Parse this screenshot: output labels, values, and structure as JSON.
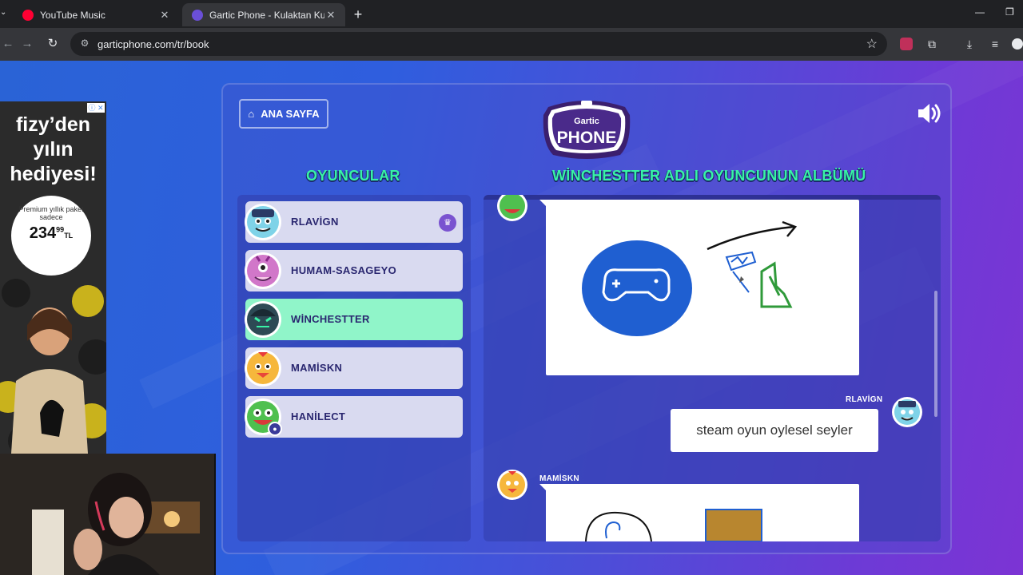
{
  "browser": {
    "tabs": [
      {
        "title": "YouTube Music",
        "favicon_color": "#ff0033",
        "active": false
      },
      {
        "title": "Gartic Phone - Kulaktan Kulağa",
        "favicon_color": "#6a4fd8",
        "active": true
      }
    ],
    "url": "garticphone.com/tr/book"
  },
  "game": {
    "home_label": "ANA SAYFA",
    "logo_top": "Gartic",
    "logo_main": "PHONE",
    "players_heading": "OYUNCULAR",
    "album_heading": "WİNCHESTTER ADLI OYUNCUNUN ALBÜMÜ",
    "players": [
      {
        "name": "RLAVİGN",
        "avatar_color": "#7fd3e8",
        "host": true,
        "active": false
      },
      {
        "name": "HUMAM-SASAGEYO",
        "avatar_color": "#d177c9",
        "host": false,
        "active": false
      },
      {
        "name": "WİNCHESTTER",
        "avatar_color": "#2d4a55",
        "host": false,
        "active": true
      },
      {
        "name": "MAMİSKN",
        "avatar_color": "#f6b73c",
        "host": false,
        "active": false
      },
      {
        "name": "HANİLECT",
        "avatar_color": "#4fc04f",
        "host": false,
        "active": false,
        "self": true
      }
    ],
    "album": {
      "entries": [
        {
          "type": "drawing",
          "author": ""
        },
        {
          "type": "text",
          "author": "RLAVİGN",
          "text": "steam oyun oylesel seyler"
        },
        {
          "type": "drawing",
          "author": "MAMİSKN"
        }
      ]
    }
  },
  "ad": {
    "line1": "fizy’den",
    "line2": "yılın",
    "line3": "hediyesi!",
    "badge_small": "Premium yıllık paket sadece",
    "price": "234",
    "price_cents": "99",
    "currency": "TL"
  },
  "colors": {
    "accent_green": "#38f3a6",
    "active_row": "#90f5c9",
    "row": "#d9daf0",
    "drawing_blue": "#1f5fd1",
    "drawing_green": "#2f9a3a"
  }
}
